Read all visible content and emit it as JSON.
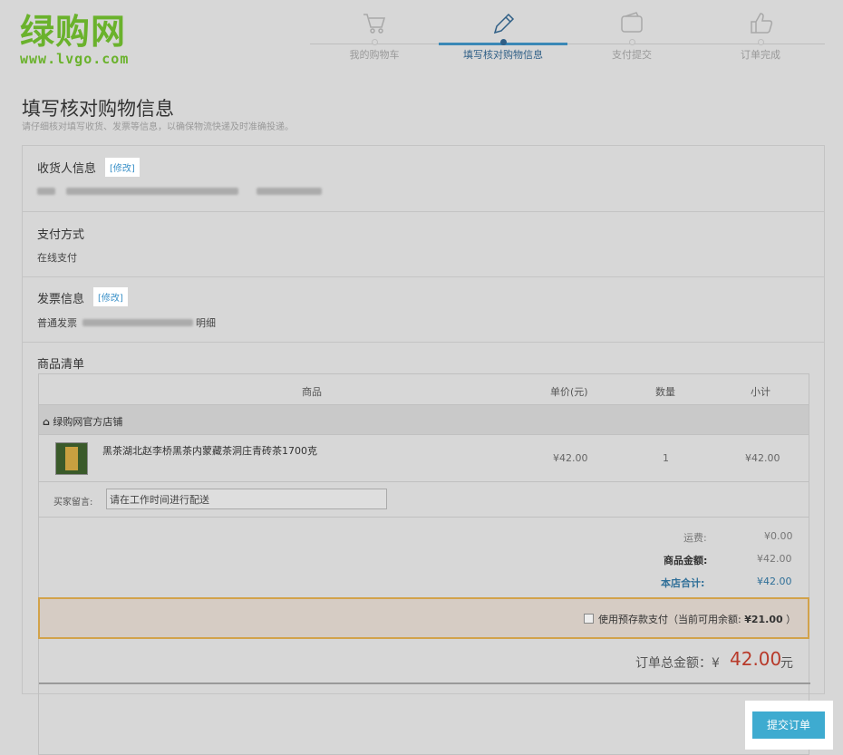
{
  "logo": {
    "name": "绿购网",
    "url": "www.lvgo.com"
  },
  "steps": [
    {
      "label": "我的购物车",
      "icon": "cart-icon"
    },
    {
      "label": "填写核对购物信息",
      "icon": "pencil-icon"
    },
    {
      "label": "支付提交",
      "icon": "wallet-icon"
    },
    {
      "label": "订单完成",
      "icon": "thumbs-up-icon"
    }
  ],
  "page": {
    "title": "填写核对购物信息",
    "subtitle": "请仔细核对填写收货、发票等信息，以确保物流快递及时准确投递。"
  },
  "receiver": {
    "title": "收货人信息",
    "edit": "[修改]"
  },
  "payment": {
    "title": "支付方式",
    "method": "在线支付"
  },
  "invoice": {
    "title": "发票信息",
    "edit": "[修改]",
    "type": "普通发票",
    "content": "明细"
  },
  "goods": {
    "title": "商品清单",
    "columns": {
      "product": "商品",
      "price": "单价(元)",
      "qty": "数量",
      "subtotal": "小计"
    },
    "shop": "绿购网官方店铺",
    "item": {
      "name": "黑茶湖北赵李桥黑茶内蒙藏茶洞庄青砖茶1700克",
      "price": "¥42.00",
      "qty": "1",
      "subtotal": "¥42.00"
    },
    "message_label": "买家留言:",
    "message_value": "请在工作时间进行配送"
  },
  "summary": {
    "shipping_label": "运费:",
    "shipping_value": "¥0.00",
    "goods_label": "商品金额:",
    "goods_value": "¥42.00",
    "store_label": "本店合计:",
    "store_value": "¥42.00"
  },
  "balance": {
    "text": "使用预存款支付（当前可用余额:",
    "amount": "¥21.00",
    "close": "）"
  },
  "total": {
    "label": "订单总金额：¥",
    "value": "42.00",
    "unit": "元"
  },
  "submit": "提交订单",
  "colors": {
    "brand_green": "#6ab22c",
    "accent_blue": "#3eabd0",
    "price_red": "#b83a2a",
    "store_total_blue": "#2f6f98"
  }
}
